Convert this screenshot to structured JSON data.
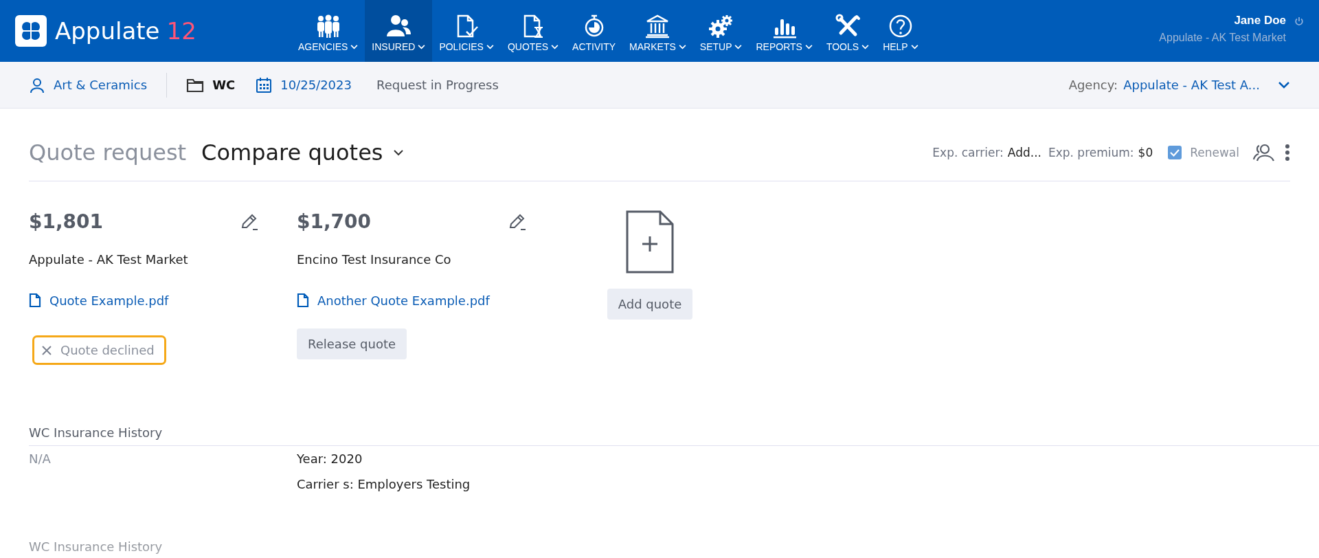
{
  "header": {
    "logo": {
      "name": "Appulate",
      "version": "12"
    },
    "nav": [
      {
        "label": "AGENCIES",
        "kind": "agencies",
        "caret": true,
        "selected": false
      },
      {
        "label": "INSURED",
        "kind": "insured",
        "caret": true,
        "selected": true
      },
      {
        "label": "POLICIES",
        "kind": "policies",
        "caret": true,
        "selected": false
      },
      {
        "label": "QUOTES",
        "kind": "quotes",
        "caret": true,
        "selected": false
      },
      {
        "label": "ACTIVITY",
        "kind": "activity",
        "caret": false,
        "selected": false
      },
      {
        "label": "MARKETS",
        "kind": "markets",
        "caret": true,
        "selected": false
      },
      {
        "label": "SETUP",
        "kind": "setup",
        "caret": true,
        "selected": false
      },
      {
        "label": "REPORTS",
        "kind": "reports",
        "caret": true,
        "selected": false
      },
      {
        "label": "TOOLS",
        "kind": "tools",
        "caret": true,
        "selected": false
      },
      {
        "label": "HELP",
        "kind": "help",
        "caret": true,
        "selected": false
      }
    ],
    "user": {
      "name": "Jane Doe",
      "company": "Appulate - AK Test Market"
    }
  },
  "subheader": {
    "insured": "Art & Ceramics",
    "line": "WC",
    "date": "10/25/2023",
    "status": "Request in Progress",
    "agency_label": "Agency:",
    "agency_value": "Appulate - AK Test A..."
  },
  "page": {
    "breadcrumb": "Quote request",
    "title": "Compare quotes",
    "exp_carrier_label": "Exp. carrier:",
    "exp_carrier_value": "Add...",
    "exp_premium_label": "Exp. premium:",
    "exp_premium_value": "$0",
    "renewal": {
      "label": "Renewal",
      "checked": true
    }
  },
  "quotes": [
    {
      "premium": "$1,801",
      "carrier": "Appulate - AK Test Market",
      "file": "Quote Example.pdf",
      "action": {
        "kind": "declined",
        "label": "Quote declined"
      }
    },
    {
      "premium": "$1,700",
      "carrier": "Encino Test Insurance Co",
      "file": "Another Quote Example.pdf",
      "action": {
        "kind": "release",
        "label": "Release quote"
      }
    }
  ],
  "add_quote": "Add quote",
  "history": [
    {
      "title": "WC Insurance History",
      "status": "N/A",
      "lines": [
        "Year: 2020",
        "Carrier s: Employers Testing"
      ]
    },
    {
      "title": "WC Insurance History"
    }
  ]
}
